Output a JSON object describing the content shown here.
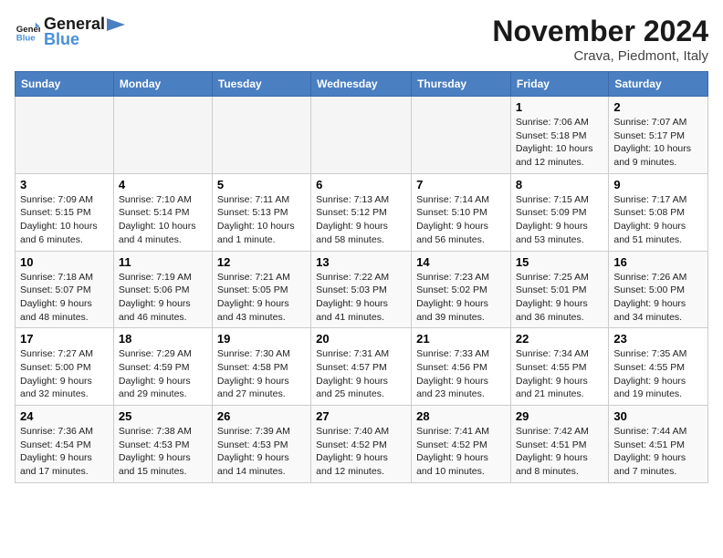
{
  "header": {
    "logo_line1": "General",
    "logo_line2": "Blue",
    "month_title": "November 2024",
    "location": "Crava, Piedmont, Italy"
  },
  "weekdays": [
    "Sunday",
    "Monday",
    "Tuesday",
    "Wednesday",
    "Thursday",
    "Friday",
    "Saturday"
  ],
  "weeks": [
    [
      {
        "day": "",
        "info": ""
      },
      {
        "day": "",
        "info": ""
      },
      {
        "day": "",
        "info": ""
      },
      {
        "day": "",
        "info": ""
      },
      {
        "day": "",
        "info": ""
      },
      {
        "day": "1",
        "info": "Sunrise: 7:06 AM\nSunset: 5:18 PM\nDaylight: 10 hours and 12 minutes."
      },
      {
        "day": "2",
        "info": "Sunrise: 7:07 AM\nSunset: 5:17 PM\nDaylight: 10 hours and 9 minutes."
      }
    ],
    [
      {
        "day": "3",
        "info": "Sunrise: 7:09 AM\nSunset: 5:15 PM\nDaylight: 10 hours and 6 minutes."
      },
      {
        "day": "4",
        "info": "Sunrise: 7:10 AM\nSunset: 5:14 PM\nDaylight: 10 hours and 4 minutes."
      },
      {
        "day": "5",
        "info": "Sunrise: 7:11 AM\nSunset: 5:13 PM\nDaylight: 10 hours and 1 minute."
      },
      {
        "day": "6",
        "info": "Sunrise: 7:13 AM\nSunset: 5:12 PM\nDaylight: 9 hours and 58 minutes."
      },
      {
        "day": "7",
        "info": "Sunrise: 7:14 AM\nSunset: 5:10 PM\nDaylight: 9 hours and 56 minutes."
      },
      {
        "day": "8",
        "info": "Sunrise: 7:15 AM\nSunset: 5:09 PM\nDaylight: 9 hours and 53 minutes."
      },
      {
        "day": "9",
        "info": "Sunrise: 7:17 AM\nSunset: 5:08 PM\nDaylight: 9 hours and 51 minutes."
      }
    ],
    [
      {
        "day": "10",
        "info": "Sunrise: 7:18 AM\nSunset: 5:07 PM\nDaylight: 9 hours and 48 minutes."
      },
      {
        "day": "11",
        "info": "Sunrise: 7:19 AM\nSunset: 5:06 PM\nDaylight: 9 hours and 46 minutes."
      },
      {
        "day": "12",
        "info": "Sunrise: 7:21 AM\nSunset: 5:05 PM\nDaylight: 9 hours and 43 minutes."
      },
      {
        "day": "13",
        "info": "Sunrise: 7:22 AM\nSunset: 5:03 PM\nDaylight: 9 hours and 41 minutes."
      },
      {
        "day": "14",
        "info": "Sunrise: 7:23 AM\nSunset: 5:02 PM\nDaylight: 9 hours and 39 minutes."
      },
      {
        "day": "15",
        "info": "Sunrise: 7:25 AM\nSunset: 5:01 PM\nDaylight: 9 hours and 36 minutes."
      },
      {
        "day": "16",
        "info": "Sunrise: 7:26 AM\nSunset: 5:00 PM\nDaylight: 9 hours and 34 minutes."
      }
    ],
    [
      {
        "day": "17",
        "info": "Sunrise: 7:27 AM\nSunset: 5:00 PM\nDaylight: 9 hours and 32 minutes."
      },
      {
        "day": "18",
        "info": "Sunrise: 7:29 AM\nSunset: 4:59 PM\nDaylight: 9 hours and 29 minutes."
      },
      {
        "day": "19",
        "info": "Sunrise: 7:30 AM\nSunset: 4:58 PM\nDaylight: 9 hours and 27 minutes."
      },
      {
        "day": "20",
        "info": "Sunrise: 7:31 AM\nSunset: 4:57 PM\nDaylight: 9 hours and 25 minutes."
      },
      {
        "day": "21",
        "info": "Sunrise: 7:33 AM\nSunset: 4:56 PM\nDaylight: 9 hours and 23 minutes."
      },
      {
        "day": "22",
        "info": "Sunrise: 7:34 AM\nSunset: 4:55 PM\nDaylight: 9 hours and 21 minutes."
      },
      {
        "day": "23",
        "info": "Sunrise: 7:35 AM\nSunset: 4:55 PM\nDaylight: 9 hours and 19 minutes."
      }
    ],
    [
      {
        "day": "24",
        "info": "Sunrise: 7:36 AM\nSunset: 4:54 PM\nDaylight: 9 hours and 17 minutes."
      },
      {
        "day": "25",
        "info": "Sunrise: 7:38 AM\nSunset: 4:53 PM\nDaylight: 9 hours and 15 minutes."
      },
      {
        "day": "26",
        "info": "Sunrise: 7:39 AM\nSunset: 4:53 PM\nDaylight: 9 hours and 14 minutes."
      },
      {
        "day": "27",
        "info": "Sunrise: 7:40 AM\nSunset: 4:52 PM\nDaylight: 9 hours and 12 minutes."
      },
      {
        "day": "28",
        "info": "Sunrise: 7:41 AM\nSunset: 4:52 PM\nDaylight: 9 hours and 10 minutes."
      },
      {
        "day": "29",
        "info": "Sunrise: 7:42 AM\nSunset: 4:51 PM\nDaylight: 9 hours and 8 minutes."
      },
      {
        "day": "30",
        "info": "Sunrise: 7:44 AM\nSunset: 4:51 PM\nDaylight: 9 hours and 7 minutes."
      }
    ]
  ]
}
